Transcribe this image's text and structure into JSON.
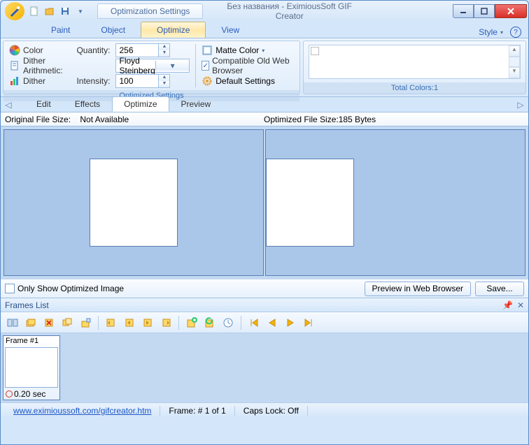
{
  "titlebar": {
    "context_tab": "Optimization Settings",
    "title": "Без названия - EximiousSoft GIF Creator"
  },
  "ribbon": {
    "tabs": {
      "paint": "Paint",
      "object": "Object",
      "optimize": "Optimize",
      "view": "View"
    },
    "style": "Style",
    "group_left_label": "Optimized Settings",
    "group_right_label": "Total Colors:1",
    "color_label": "Color",
    "quantity_label": "Quantity:",
    "quantity_value": "256",
    "dither_arith_label": "Dither Arithmetic:",
    "dither_arith_value": "Floyd Steinberg",
    "dither_label": "Dither",
    "intensity_label": "Intensity:",
    "intensity_value": "100",
    "matte_color": "Matte Color",
    "compat_label": "Compatible Old Web Browser",
    "default_settings": "Default Settings"
  },
  "subtabs": {
    "edit": "Edit",
    "effects": "Effects",
    "optimize": "Optimize",
    "preview": "Preview"
  },
  "filesize": {
    "orig_label": "Original File Size:",
    "orig_value": "Not Available",
    "opt_label": "Optimized File Size:",
    "opt_value": "185 Bytes"
  },
  "controls": {
    "only_show": "Only Show Optimized Image",
    "preview_btn": "Preview in Web Browser",
    "save_btn": "Save..."
  },
  "frames": {
    "header": "Frames List",
    "frame1_title": "Frame #1",
    "frame1_time": "0.20 sec"
  },
  "status": {
    "url": "www.eximioussoft.com/gifcreator.htm",
    "frame": "Frame: # 1 of 1",
    "caps": "Caps Lock: Off"
  }
}
